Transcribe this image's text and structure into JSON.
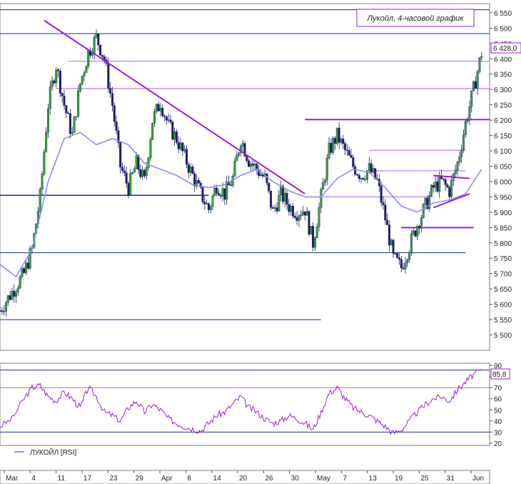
{
  "chart_data": [
    {
      "type": "candlestick",
      "title": "Лукойл, 4-часовой график",
      "last_price_label": "6 428,0",
      "ylim": [
        5450,
        6580
      ],
      "y_ticks": [
        5500,
        5550,
        5600,
        5650,
        5700,
        5750,
        5800,
        5850,
        5900,
        5950,
        6000,
        6050,
        6100,
        6150,
        6200,
        6250,
        6300,
        6350,
        6400,
        6450,
        6500,
        6550
      ],
      "y_tick_labels": [
        "5 500",
        "5 550",
        "5 600",
        "5 650",
        "5 700",
        "5 750",
        "5 800",
        "5 850",
        "5 900",
        "5 950",
        "6 000",
        "6 050",
        "6 100",
        "6 150",
        "6 200",
        "6 250",
        "6 300",
        "6 350",
        "6 400",
        "6 450",
        "6 500",
        "6 550"
      ],
      "x_tick_labels": [
        "Mar",
        "4",
        "11",
        "17",
        "23",
        "29",
        "Apr",
        "8",
        "14",
        "20",
        "26",
        "30",
        "May",
        "7",
        "13",
        "19",
        "25",
        "31",
        "Jun"
      ],
      "close_path": [
        [
          0,
          5580
        ],
        [
          3,
          5640
        ],
        [
          6,
          5700
        ],
        [
          8,
          5780
        ],
        [
          10,
          5950
        ],
        [
          12,
          6250
        ],
        [
          14,
          6380
        ],
        [
          16,
          6250
        ],
        [
          18,
          6150
        ],
        [
          20,
          6320
        ],
        [
          22,
          6420
        ],
        [
          24,
          6470
        ],
        [
          26,
          6400
        ],
        [
          28,
          6250
        ],
        [
          30,
          6050
        ],
        [
          32,
          5980
        ],
        [
          34,
          6060
        ],
        [
          36,
          6000
        ],
        [
          38,
          6200
        ],
        [
          40,
          6260
        ],
        [
          42,
          6180
        ],
        [
          44,
          6140
        ],
        [
          46,
          6080
        ],
        [
          48,
          6020
        ],
        [
          50,
          5960
        ],
        [
          52,
          5910
        ],
        [
          54,
          5990
        ],
        [
          56,
          5960
        ],
        [
          58,
          6010
        ],
        [
          60,
          6140
        ],
        [
          62,
          6070
        ],
        [
          64,
          6040
        ],
        [
          66,
          6010
        ],
        [
          68,
          5900
        ],
        [
          70,
          5960
        ],
        [
          72,
          5920
        ],
        [
          74,
          5900
        ],
        [
          76,
          5910
        ],
        [
          78,
          5800
        ],
        [
          80,
          5950
        ],
        [
          82,
          6100
        ],
        [
          84,
          6150
        ],
        [
          86,
          6100
        ],
        [
          88,
          6050
        ],
        [
          90,
          6020
        ],
        [
          92,
          6040
        ],
        [
          94,
          6000
        ],
        [
          96,
          5880
        ],
        [
          98,
          5750
        ],
        [
          100,
          5720
        ],
        [
          102,
          5790
        ],
        [
          104,
          5860
        ],
        [
          106,
          5920
        ],
        [
          108,
          5980
        ],
        [
          110,
          6000
        ],
        [
          112,
          5970
        ],
        [
          114,
          6060
        ],
        [
          116,
          6190
        ],
        [
          118,
          6300
        ],
        [
          120,
          6420
        ]
      ],
      "ma_path": [
        [
          0,
          5730
        ],
        [
          4,
          5690
        ],
        [
          8,
          5780
        ],
        [
          12,
          6000
        ],
        [
          16,
          6140
        ],
        [
          20,
          6160
        ],
        [
          24,
          6120
        ],
        [
          28,
          6140
        ],
        [
          32,
          6120
        ],
        [
          36,
          6060
        ],
        [
          40,
          6040
        ],
        [
          44,
          6020
        ],
        [
          48,
          5990
        ],
        [
          52,
          5980
        ],
        [
          56,
          5990
        ],
        [
          60,
          6020
        ],
        [
          64,
          6040
        ],
        [
          68,
          6000
        ],
        [
          72,
          5970
        ],
        [
          76,
          5950
        ],
        [
          80,
          5950
        ],
        [
          84,
          6010
        ],
        [
          88,
          6040
        ],
        [
          92,
          6030
        ],
        [
          96,
          5980
        ],
        [
          100,
          5920
        ],
        [
          104,
          5900
        ],
        [
          108,
          5930
        ],
        [
          112,
          5940
        ],
        [
          116,
          5960
        ],
        [
          120,
          6040
        ]
      ],
      "trendlines": [
        {
          "from": [
            11,
            6525
          ],
          "to": [
            76,
            5960
          ],
          "color": "#9a1fd6",
          "width": 2
        },
        {
          "from": [
            108,
            5915
          ],
          "to": [
            117,
            5960
          ],
          "color": "#9a1fd6",
          "width": 2
        },
        {
          "from": [
            108,
            6020
          ],
          "to": [
            117,
            6010
          ],
          "color": "#9a1fd6",
          "width": 2
        }
      ],
      "hlines": [
        {
          "y": 6560,
          "x0": 0,
          "x1": 122,
          "color": "#1a2f8f",
          "width": 1
        },
        {
          "y": 6482,
          "x0": 0,
          "x1": 122,
          "color": "#1a2f8f",
          "width": 1
        },
        {
          "y": 6392,
          "x0": 17,
          "x1": 122,
          "color": "#b060d8",
          "width": 1
        },
        {
          "y": 6303,
          "x0": 14,
          "x1": 122,
          "color": "#b060d8",
          "width": 1
        },
        {
          "y": 6202,
          "x0": 76,
          "x1": 122,
          "color": "#9a1fd6",
          "width": 2
        },
        {
          "y": 6102,
          "x0": 92,
          "x1": 116,
          "color": "#b060d8",
          "width": 1
        },
        {
          "y": 6035,
          "x0": 92,
          "x1": 116,
          "color": "#b060d8",
          "width": 1
        },
        {
          "y": 5955,
          "x0": 0,
          "x1": 52,
          "color": "#1a2f8f",
          "width": 1.5
        },
        {
          "y": 5950,
          "x0": 78,
          "x1": 108,
          "color": "#b060d8",
          "width": 1
        },
        {
          "y": 5850,
          "x0": 100,
          "x1": 118,
          "color": "#9a1fd6",
          "width": 2
        },
        {
          "y": 5768,
          "x0": 0,
          "x1": 116,
          "color": "#1a2f8f",
          "width": 1
        },
        {
          "y": 5550,
          "x0": 0,
          "x1": 80,
          "color": "#1a2f8f",
          "width": 1
        }
      ]
    },
    {
      "type": "line",
      "series": [
        {
          "name": "ЛУКОЙЛ [RSI]"
        }
      ],
      "ylim": [
        18,
        92
      ],
      "y_ticks": [
        20,
        30,
        40,
        50,
        60,
        70,
        80,
        90
      ],
      "y_tick_labels": [
        "20",
        "30",
        "40",
        "50",
        "60",
        "70",
        "80",
        "90"
      ],
      "last_value_label": "85,8",
      "levels": [
        {
          "y": 85.8,
          "color": "#1a2f8f"
        },
        {
          "y": 70,
          "color": "#b060d8"
        },
        {
          "y": 30,
          "color": "#1a2f8f"
        }
      ],
      "values": [
        [
          0,
          35
        ],
        [
          3,
          42
        ],
        [
          6,
          60
        ],
        [
          8,
          70
        ],
        [
          10,
          72
        ],
        [
          12,
          62
        ],
        [
          14,
          58
        ],
        [
          16,
          66
        ],
        [
          18,
          60
        ],
        [
          20,
          52
        ],
        [
          22,
          70
        ],
        [
          24,
          62
        ],
        [
          26,
          48
        ],
        [
          28,
          45
        ],
        [
          30,
          40
        ],
        [
          32,
          52
        ],
        [
          34,
          58
        ],
        [
          36,
          48
        ],
        [
          38,
          55
        ],
        [
          40,
          50
        ],
        [
          42,
          42
        ],
        [
          44,
          38
        ],
        [
          46,
          35
        ],
        [
          48,
          33
        ],
        [
          50,
          31
        ],
        [
          52,
          38
        ],
        [
          54,
          45
        ],
        [
          56,
          48
        ],
        [
          58,
          55
        ],
        [
          60,
          62
        ],
        [
          62,
          52
        ],
        [
          64,
          48
        ],
        [
          66,
          42
        ],
        [
          68,
          38
        ],
        [
          70,
          40
        ],
        [
          72,
          45
        ],
        [
          74,
          42
        ],
        [
          76,
          38
        ],
        [
          78,
          32
        ],
        [
          80,
          48
        ],
        [
          82,
          65
        ],
        [
          84,
          70
        ],
        [
          86,
          60
        ],
        [
          88,
          52
        ],
        [
          90,
          48
        ],
        [
          92,
          45
        ],
        [
          94,
          40
        ],
        [
          96,
          35
        ],
        [
          98,
          29
        ],
        [
          100,
          32
        ],
        [
          102,
          40
        ],
        [
          104,
          48
        ],
        [
          106,
          55
        ],
        [
          108,
          60
        ],
        [
          110,
          62
        ],
        [
          112,
          58
        ],
        [
          114,
          68
        ],
        [
          116,
          75
        ],
        [
          118,
          82
        ],
        [
          120,
          86
        ]
      ]
    }
  ]
}
